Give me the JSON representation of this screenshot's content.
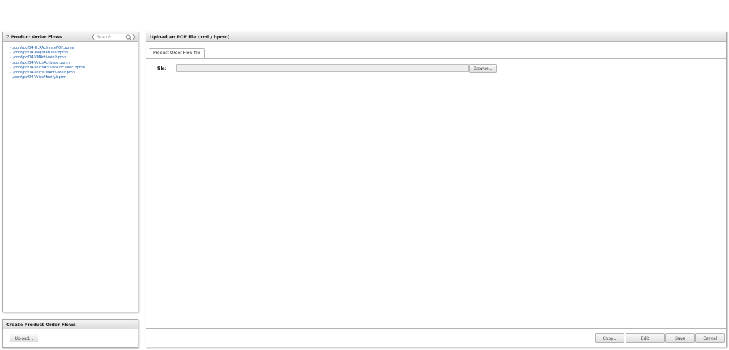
{
  "flows_panel": {
    "title": "7 Product Order Flows",
    "search_placeholder": "Search",
    "items": [
      "- ./conf/pof04-HLRActivatePOF.bpmn",
      "- ./conf/pof04-RegisterLine.bpmn",
      "- ./conf/pof04-VMActivate.bpmn",
      "- ./conf/pof04-VoiceActivate.bpmn",
      "- ./conf/pof04-VoiceActivateIncluded.bpmn",
      "- ./conf/pof04-VoiceDeActivate.bpmn",
      "- ./conf/pof04-VoiceModify.bpmn"
    ]
  },
  "create_panel": {
    "title": "Create Product Order Flows",
    "upload_label": "Upload..."
  },
  "upload_panel": {
    "title": "Upload an POF file (xml / bpmn)",
    "tab_label": "Product Order Flow file",
    "file_label": "file:",
    "browse_label": "Browse...",
    "footer": {
      "copy_label": "Copy...",
      "edit_label": "Edit",
      "save_label": "Save",
      "cancel_label": "Cancel"
    }
  }
}
